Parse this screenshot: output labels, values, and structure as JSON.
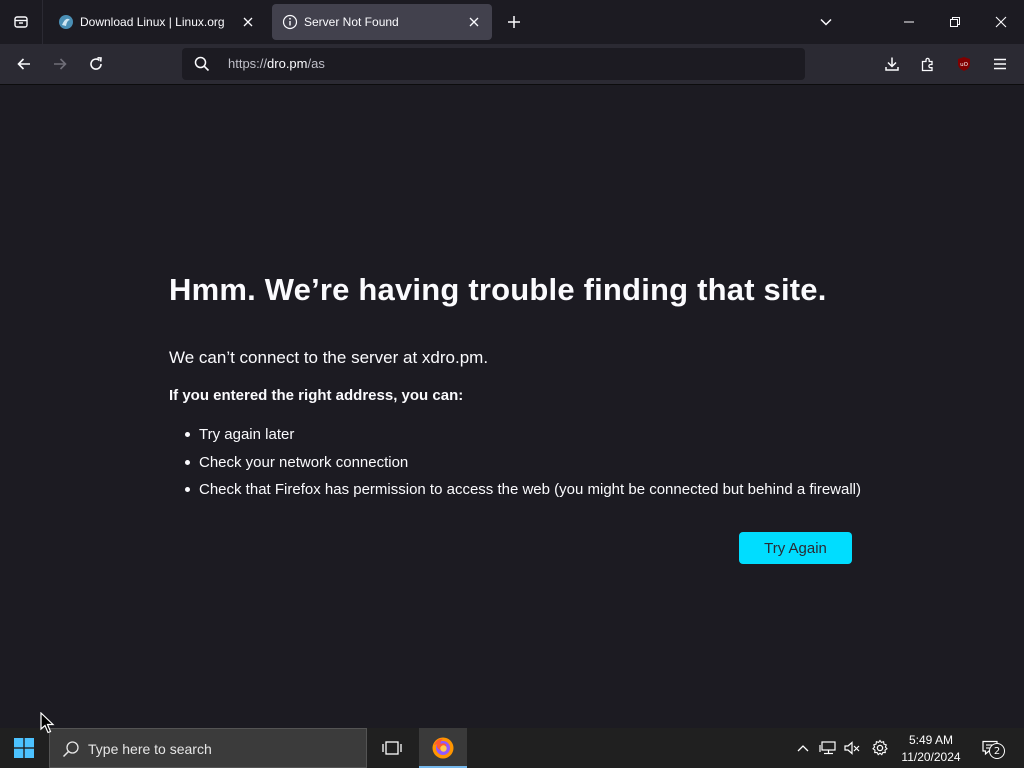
{
  "browser": {
    "tabs": [
      {
        "label": "Download Linux | Linux.org",
        "active": false,
        "icon": "linux-org-favicon"
      },
      {
        "label": "Server Not Found",
        "active": true,
        "icon": "info-icon"
      }
    ],
    "url": {
      "scheme": "https://",
      "host": "dro.pm",
      "path": "/as"
    }
  },
  "page": {
    "title": "Hmm. We’re having trouble finding that site.",
    "short_desc": "We can’t connect to the server at xdro.pm.",
    "subheading": "If you entered the right address, you can:",
    "suggestions": [
      "Try again later",
      "Check your network connection",
      "Check that Firefox has permission to access the web (you might be connected but behind a firewall)"
    ],
    "try_again_label": "Try Again"
  },
  "taskbar": {
    "search_placeholder": "Type here to search",
    "time": "5:49 AM",
    "date": "11/20/2024",
    "notification_count": "2"
  },
  "colors": {
    "accent": "#00ddff",
    "page_bg": "#1c1b22",
    "toolbar_bg": "#2b2a33",
    "active_tab_bg": "#42414d",
    "taskbar_bg": "#202020"
  }
}
